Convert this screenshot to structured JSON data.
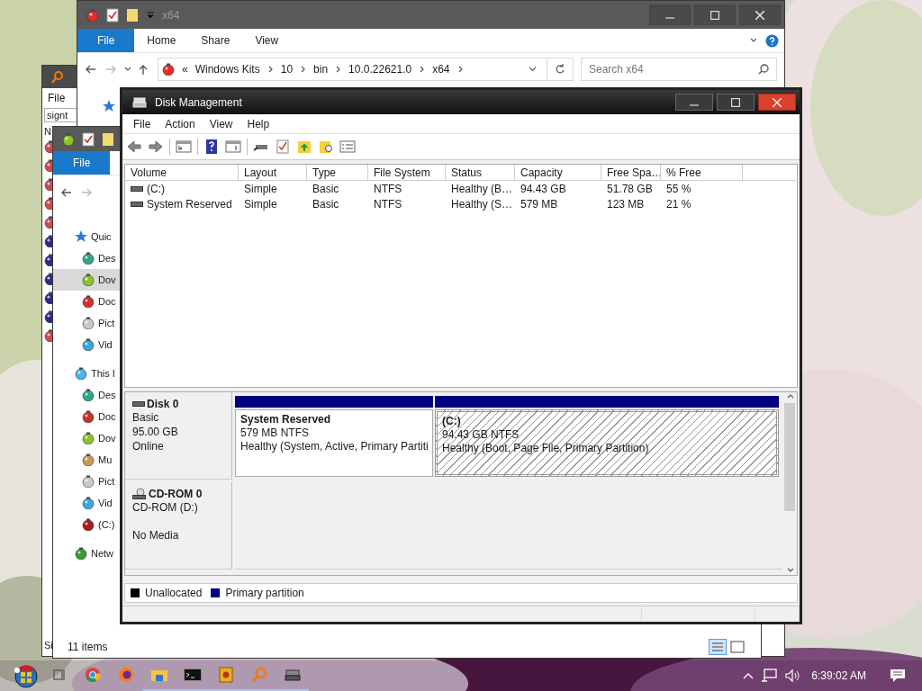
{
  "back_window": {
    "menu": "File",
    "field": "signt",
    "column": "N",
    "status": "Si"
  },
  "explorer_top": {
    "title": "x64",
    "ribbon_tabs": [
      {
        "label": "File",
        "kind": "file"
      },
      {
        "label": "Home",
        "kind": "tab"
      },
      {
        "label": "Share",
        "kind": "tab"
      },
      {
        "label": "View",
        "kind": "tab"
      }
    ],
    "overflow": "«",
    "breadcrumb": [
      "Windows Kits",
      "10",
      "bin",
      "10.0.22621.0",
      "x64"
    ],
    "search": {
      "placeholder": "Search x64"
    }
  },
  "explorer_left": {
    "ribbon_tabs": [
      {
        "label": "File",
        "kind": "file"
      }
    ],
    "nav": [
      {
        "label": "Quic",
        "kind": "pinned",
        "selected": false,
        "children": [
          {
            "label": "Des",
            "color": "#2fa88a",
            "selected": false
          },
          {
            "label": "Dov",
            "color": "#8cc22a",
            "selected": true
          },
          {
            "label": "Doc",
            "color": "#d0302c",
            "selected": false
          },
          {
            "label": "Pict",
            "color": "#c8c8c8",
            "selected": false
          },
          {
            "label": "Vid",
            "color": "#3aa6e0",
            "selected": false
          }
        ]
      },
      {
        "label": "This I",
        "kind": "place",
        "color": "#4ab4e6",
        "selected": false,
        "children": [
          {
            "label": "Des",
            "color": "#2fa88a",
            "selected": false
          },
          {
            "label": "Doc",
            "color": "#d0302c",
            "selected": false
          },
          {
            "label": "Dov",
            "color": "#8cc22a",
            "selected": false
          },
          {
            "label": "Mu",
            "color": "#c89a5a",
            "selected": false
          },
          {
            "label": "Pict",
            "color": "#c8c8c8",
            "selected": false
          },
          {
            "label": "Vid",
            "color": "#3aa6e0",
            "selected": false
          },
          {
            "label": "(C:)",
            "color": "#b01818",
            "selected": false
          }
        ]
      },
      {
        "label": "Netw",
        "kind": "place",
        "color": "#3a9a3a",
        "selected": false
      }
    ],
    "status": "11 items"
  },
  "disk_management": {
    "title": "Disk Management",
    "menu": [
      "File",
      "Action",
      "View",
      "Help"
    ],
    "volume_table": {
      "columns": [
        "Volume",
        "Layout",
        "Type",
        "File System",
        "Status",
        "Capacity",
        "Free Spa…",
        "% Free"
      ],
      "rows": [
        [
          "(C:)",
          "Simple",
          "Basic",
          "NTFS",
          "Healthy (B…",
          "94.43 GB",
          "51.78 GB",
          "55 %"
        ],
        [
          "System Reserved",
          "Simple",
          "Basic",
          "NTFS",
          "Healthy (S…",
          "579 MB",
          "123 MB",
          "21 %"
        ]
      ]
    },
    "disks": [
      {
        "name": "Disk 0",
        "kind": "disk",
        "lines": [
          "Basic",
          "95.00 GB",
          "Online"
        ],
        "partitions": [
          {
            "name": "System Reserved",
            "size": "579 MB NTFS",
            "status": "Healthy (System, Active, Primary Partiti",
            "selected": false
          },
          {
            "name": "(C:)",
            "size": "94.43 GB NTFS",
            "status": "Healthy (Boot, Page File, Primary Partition)",
            "selected": true
          }
        ]
      },
      {
        "name": "CD-ROM 0",
        "kind": "cdrom",
        "lines": [
          "CD-ROM (D:)"
        ],
        "media": "No Media"
      }
    ],
    "legend": [
      {
        "label": "Unallocated",
        "color": "#000000"
      },
      {
        "label": "Primary partition",
        "color": "#000080"
      }
    ]
  },
  "taskbar": {
    "items": [
      {
        "kind": "start",
        "running": false
      },
      {
        "kind": "taskview",
        "running": false
      },
      {
        "kind": "chrome",
        "running": false
      },
      {
        "kind": "firefox",
        "running": false
      },
      {
        "kind": "explorer",
        "running": true
      },
      {
        "kind": "cmd",
        "running": true
      },
      {
        "kind": "book",
        "running": true
      },
      {
        "kind": "search",
        "running": true
      },
      {
        "kind": "disk",
        "running": true
      }
    ],
    "time": "6:39:02 AM"
  }
}
